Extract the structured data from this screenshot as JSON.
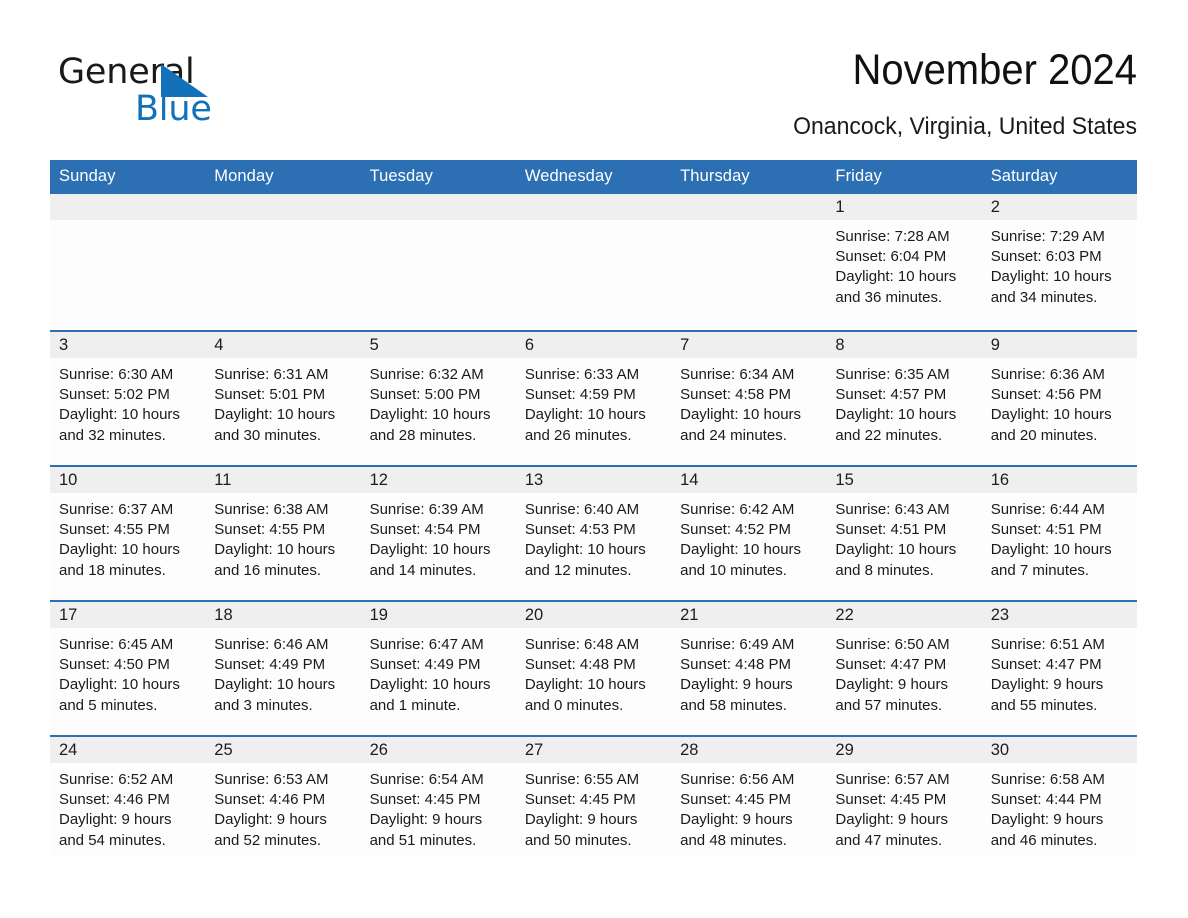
{
  "brand": {
    "name_part1": "General",
    "name_part2": "Blue",
    "accent_color": "#1271b8",
    "triangle_icon": "triangle-right-icon"
  },
  "header": {
    "title": "November 2024",
    "location": "Onancock, Virginia, United States"
  },
  "calendar": {
    "header_bg": "#2c70b3",
    "daynum_bg": "#efeff0",
    "weekday_headers": [
      "Sunday",
      "Monday",
      "Tuesday",
      "Wednesday",
      "Thursday",
      "Friday",
      "Saturday"
    ],
    "weeks": [
      [
        {
          "day": "",
          "info": ""
        },
        {
          "day": "",
          "info": ""
        },
        {
          "day": "",
          "info": ""
        },
        {
          "day": "",
          "info": ""
        },
        {
          "day": "",
          "info": ""
        },
        {
          "day": "1",
          "info": "Sunrise: 7:28 AM\nSunset: 6:04 PM\nDaylight: 10 hours\nand 36 minutes."
        },
        {
          "day": "2",
          "info": "Sunrise: 7:29 AM\nSunset: 6:03 PM\nDaylight: 10 hours\nand 34 minutes."
        }
      ],
      [
        {
          "day": "3",
          "info": "Sunrise: 6:30 AM\nSunset: 5:02 PM\nDaylight: 10 hours\nand 32 minutes."
        },
        {
          "day": "4",
          "info": "Sunrise: 6:31 AM\nSunset: 5:01 PM\nDaylight: 10 hours\nand 30 minutes."
        },
        {
          "day": "5",
          "info": "Sunrise: 6:32 AM\nSunset: 5:00 PM\nDaylight: 10 hours\nand 28 minutes."
        },
        {
          "day": "6",
          "info": "Sunrise: 6:33 AM\nSunset: 4:59 PM\nDaylight: 10 hours\nand 26 minutes."
        },
        {
          "day": "7",
          "info": "Sunrise: 6:34 AM\nSunset: 4:58 PM\nDaylight: 10 hours\nand 24 minutes."
        },
        {
          "day": "8",
          "info": "Sunrise: 6:35 AM\nSunset: 4:57 PM\nDaylight: 10 hours\nand 22 minutes."
        },
        {
          "day": "9",
          "info": "Sunrise: 6:36 AM\nSunset: 4:56 PM\nDaylight: 10 hours\nand 20 minutes."
        }
      ],
      [
        {
          "day": "10",
          "info": "Sunrise: 6:37 AM\nSunset: 4:55 PM\nDaylight: 10 hours\nand 18 minutes."
        },
        {
          "day": "11",
          "info": "Sunrise: 6:38 AM\nSunset: 4:55 PM\nDaylight: 10 hours\nand 16 minutes."
        },
        {
          "day": "12",
          "info": "Sunrise: 6:39 AM\nSunset: 4:54 PM\nDaylight: 10 hours\nand 14 minutes."
        },
        {
          "day": "13",
          "info": "Sunrise: 6:40 AM\nSunset: 4:53 PM\nDaylight: 10 hours\nand 12 minutes."
        },
        {
          "day": "14",
          "info": "Sunrise: 6:42 AM\nSunset: 4:52 PM\nDaylight: 10 hours\nand 10 minutes."
        },
        {
          "day": "15",
          "info": "Sunrise: 6:43 AM\nSunset: 4:51 PM\nDaylight: 10 hours\nand 8 minutes."
        },
        {
          "day": "16",
          "info": "Sunrise: 6:44 AM\nSunset: 4:51 PM\nDaylight: 10 hours\nand 7 minutes."
        }
      ],
      [
        {
          "day": "17",
          "info": "Sunrise: 6:45 AM\nSunset: 4:50 PM\nDaylight: 10 hours\nand 5 minutes."
        },
        {
          "day": "18",
          "info": "Sunrise: 6:46 AM\nSunset: 4:49 PM\nDaylight: 10 hours\nand 3 minutes."
        },
        {
          "day": "19",
          "info": "Sunrise: 6:47 AM\nSunset: 4:49 PM\nDaylight: 10 hours\nand 1 minute."
        },
        {
          "day": "20",
          "info": "Sunrise: 6:48 AM\nSunset: 4:48 PM\nDaylight: 10 hours\nand 0 minutes."
        },
        {
          "day": "21",
          "info": "Sunrise: 6:49 AM\nSunset: 4:48 PM\nDaylight: 9 hours\nand 58 minutes."
        },
        {
          "day": "22",
          "info": "Sunrise: 6:50 AM\nSunset: 4:47 PM\nDaylight: 9 hours\nand 57 minutes."
        },
        {
          "day": "23",
          "info": "Sunrise: 6:51 AM\nSunset: 4:47 PM\nDaylight: 9 hours\nand 55 minutes."
        }
      ],
      [
        {
          "day": "24",
          "info": "Sunrise: 6:52 AM\nSunset: 4:46 PM\nDaylight: 9 hours\nand 54 minutes."
        },
        {
          "day": "25",
          "info": "Sunrise: 6:53 AM\nSunset: 4:46 PM\nDaylight: 9 hours\nand 52 minutes."
        },
        {
          "day": "26",
          "info": "Sunrise: 6:54 AM\nSunset: 4:45 PM\nDaylight: 9 hours\nand 51 minutes."
        },
        {
          "day": "27",
          "info": "Sunrise: 6:55 AM\nSunset: 4:45 PM\nDaylight: 9 hours\nand 50 minutes."
        },
        {
          "day": "28",
          "info": "Sunrise: 6:56 AM\nSunset: 4:45 PM\nDaylight: 9 hours\nand 48 minutes."
        },
        {
          "day": "29",
          "info": "Sunrise: 6:57 AM\nSunset: 4:45 PM\nDaylight: 9 hours\nand 47 minutes."
        },
        {
          "day": "30",
          "info": "Sunrise: 6:58 AM\nSunset: 4:44 PM\nDaylight: 9 hours\nand 46 minutes."
        }
      ]
    ]
  }
}
